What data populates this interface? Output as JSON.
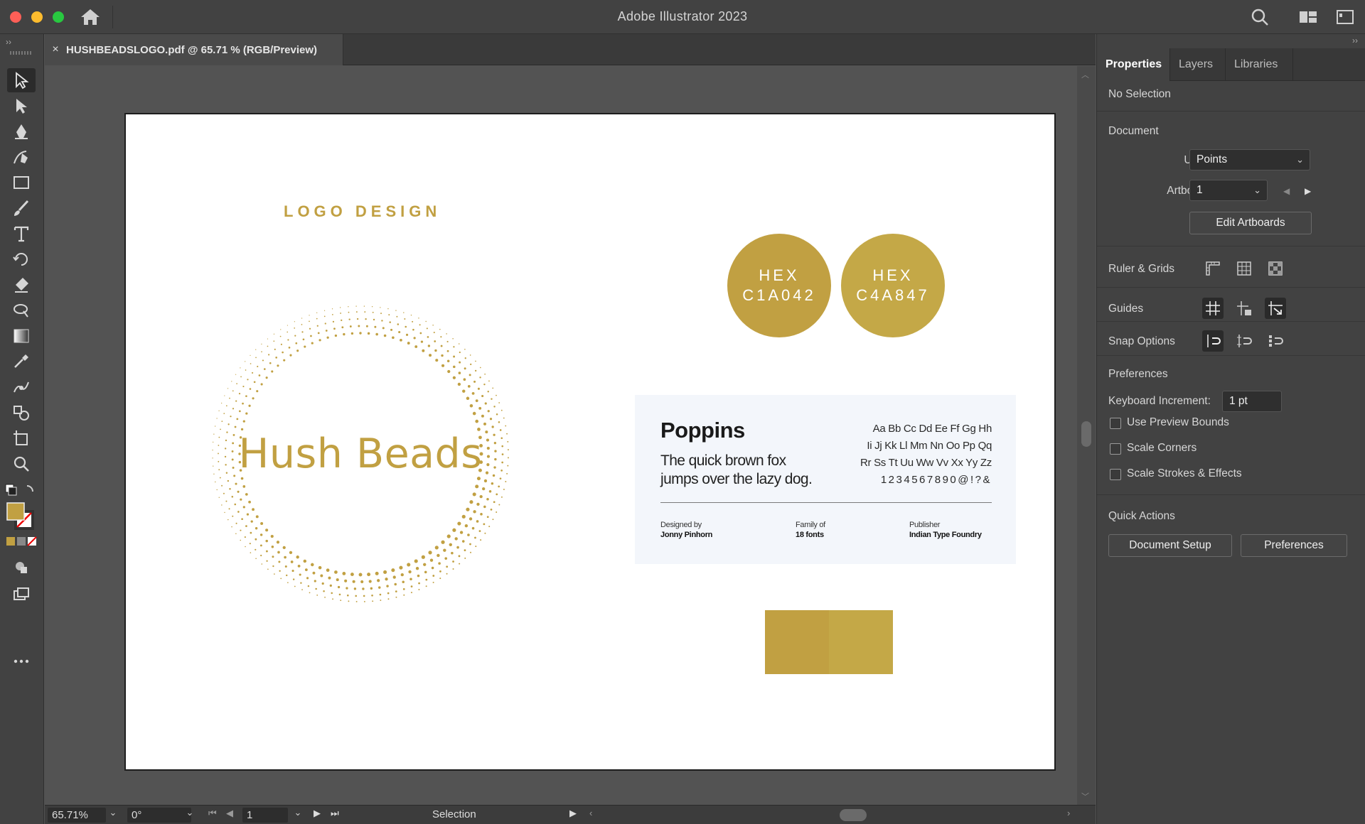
{
  "app": {
    "title": "Adobe Illustrator 2023"
  },
  "document_tab": {
    "label": "HUSHBEADSLOGO.pdf @ 65.71 % (RGB/Preview)",
    "close_glyph": "×"
  },
  "artboard": {
    "heading": "LOGO DESIGN",
    "brand_name": "Hush Beads",
    "colors": [
      {
        "label": "HEX",
        "code": "C1A042",
        "hex": "#c1a042"
      },
      {
        "label": "HEX",
        "code": "C4A847",
        "hex": "#c4a847"
      }
    ],
    "font_card": {
      "name": "Poppins",
      "sample_line1": "The quick brown fox",
      "sample_line2": "jumps over the lazy dog.",
      "alphabet": [
        "Aa Bb Cc Dd Ee Ff Gg Hh",
        "Ii Jj Kk Ll Mm Nn Oo Pp Qq",
        "Rr Ss Tt Uu Ww Vv Xx Yy Zz",
        "1234567890@!?&"
      ],
      "designed_by_label": "Designed by",
      "designed_by_value": "Jonny Pinhorn",
      "family_label": "Family of",
      "family_value": "18 fonts",
      "publisher_label": "Publisher",
      "publisher_value": "Indian Type Foundry"
    }
  },
  "statusbar": {
    "zoom": "65.71%",
    "rotation": "0°",
    "artboard_number": "1",
    "status": "Selection"
  },
  "right_panel": {
    "tabs": [
      "Properties",
      "Layers",
      "Libraries"
    ],
    "selection": "No Selection",
    "document_heading": "Document",
    "units_label": "Units:",
    "units_value": "Points",
    "artboard_label": "Artboard:",
    "artboard_value": "1",
    "edit_artboards": "Edit Artboards",
    "ruler_grids": "Ruler & Grids",
    "guides": "Guides",
    "snap_options": "Snap Options",
    "preferences_heading": "Preferences",
    "keyboard_increment_label": "Keyboard Increment:",
    "keyboard_increment_value": "1 pt",
    "checkboxes": [
      "Use Preview Bounds",
      "Scale Corners",
      "Scale Strokes & Effects"
    ],
    "quick_actions": "Quick Actions",
    "document_setup": "Document Setup",
    "preferences_button": "Preferences"
  },
  "colors": {
    "accent_gold": "#c1a042",
    "accent_gold_2": "#c4a847",
    "fill_swatch": "#c1a042"
  }
}
